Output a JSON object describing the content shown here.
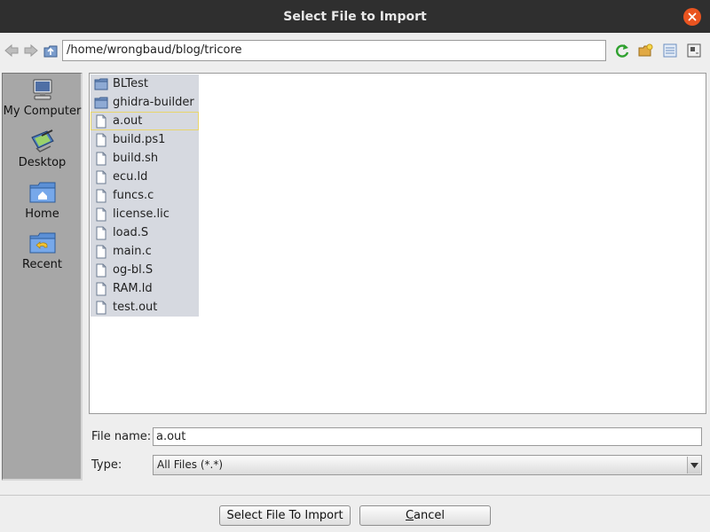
{
  "window": {
    "title": "Select File to Import"
  },
  "toolbar": {
    "path": "/home/wrongbaud/blog/tricore",
    "icons": [
      "back-arrow-icon",
      "forward-arrow-icon",
      "up-folder-icon",
      "refresh-icon",
      "new-folder-icon",
      "list-view-icon",
      "details-view-icon"
    ]
  },
  "shortcuts": [
    {
      "label": "My Computer",
      "icon": "computer-icon"
    },
    {
      "label": "Desktop",
      "icon": "desktop-icon"
    },
    {
      "label": "Home",
      "icon": "home-folder-icon"
    },
    {
      "label": "Recent",
      "icon": "recent-folder-icon"
    }
  ],
  "files": [
    {
      "name": "BLTest",
      "type": "folder"
    },
    {
      "name": "ghidra-builder",
      "type": "folder"
    },
    {
      "name": "a.out",
      "type": "file",
      "selected": true
    },
    {
      "name": "build.ps1",
      "type": "file"
    },
    {
      "name": "build.sh",
      "type": "file"
    },
    {
      "name": "ecu.ld",
      "type": "file"
    },
    {
      "name": "funcs.c",
      "type": "file"
    },
    {
      "name": "license.lic",
      "type": "file"
    },
    {
      "name": "load.S",
      "type": "file"
    },
    {
      "name": "main.c",
      "type": "file"
    },
    {
      "name": "og-bl.S",
      "type": "file"
    },
    {
      "name": "RAM.ld",
      "type": "file"
    },
    {
      "name": "test.out",
      "type": "file"
    }
  ],
  "form": {
    "filename_label": "File name:",
    "filename_value": "a.out",
    "type_label": "Type:",
    "type_value": "All Files (*.*)"
  },
  "buttons": {
    "import_label": "Select File To Import",
    "cancel_first": "C",
    "cancel_rest": "ancel"
  },
  "colors": {
    "titlebar": "#2f2f2f",
    "close": "#e95420",
    "shortcut_panel": "#a7a7a7",
    "file_column": "#d6d9e0",
    "selection_outline": "#e8d56a"
  }
}
